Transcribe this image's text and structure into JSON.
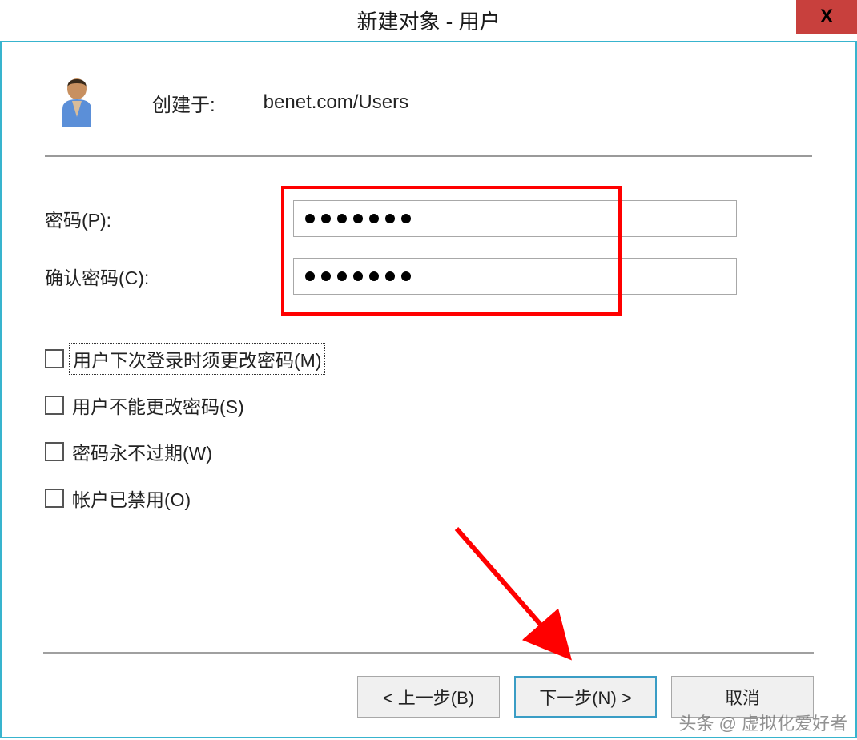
{
  "title": "新建对象 - 用户",
  "close_label": "X",
  "header": {
    "created_label": "创建于:",
    "created_value": "benet.com/Users"
  },
  "fields": {
    "password_label": "密码(P):",
    "password_value": "●●●●●●●",
    "confirm_label": "确认密码(C):",
    "confirm_value": "●●●●●●●"
  },
  "checkboxes": {
    "must_change": "用户下次登录时须更改密码(M)",
    "cannot_change": "用户不能更改密码(S)",
    "never_expires": "密码永不过期(W)",
    "disabled": "帐户已禁用(O)"
  },
  "buttons": {
    "back": "< 上一步(B)",
    "next": "下一步(N) >",
    "cancel": "取消"
  },
  "watermark": "头条 @ 虚拟化爱好者"
}
